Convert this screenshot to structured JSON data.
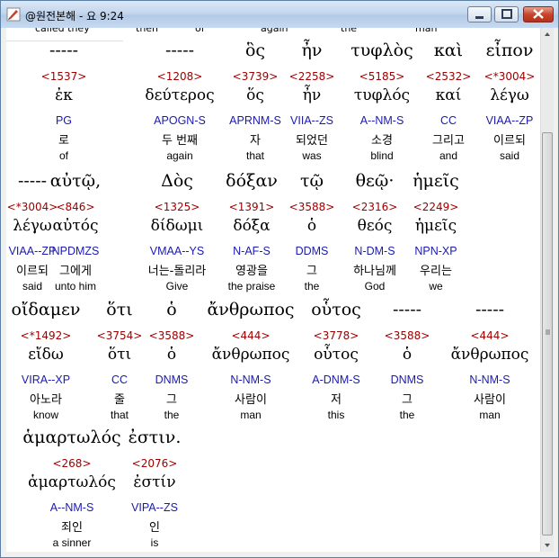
{
  "window": {
    "title": "@원전본해 - 요 9:24",
    "controls": {
      "minimize_icon": "minimize-icon",
      "maximize_icon": "maximize-icon",
      "close_icon": "close-icon"
    }
  },
  "cut_row": [
    "called they",
    "then",
    "of",
    "again",
    "the",
    "man"
  ],
  "blocks": [
    {
      "words": [
        {
          "greek": "-----",
          "number": "<1537>",
          "lemma": "ἐκ",
          "parse": "PG",
          "korean": "로",
          "english": "of"
        },
        {
          "greek": "-----",
          "number": "<1208>",
          "lemma": "δεύτερος",
          "parse": "APOGN-S",
          "korean": "두 번째",
          "english": "again"
        },
        {
          "greek": "ὃς",
          "number": "<3739>",
          "lemma": "ὅς",
          "parse": "APRNM-S",
          "korean": "자",
          "english": "that"
        },
        {
          "greek": "ἦν",
          "number": "<2258>",
          "lemma": "ἦν",
          "parse": "VIIA--ZS",
          "korean": "되었던",
          "english": "was"
        },
        {
          "greek": "τυφλὸς",
          "number": "<5185>",
          "lemma": "τυφλός",
          "parse": "A--NM-S",
          "korean": "소경",
          "english": "blind"
        },
        {
          "greek": "καὶ",
          "number": "<2532>",
          "lemma": "καί",
          "parse": "CC",
          "korean": "그리고",
          "english": "and"
        },
        {
          "greek": "εἶπον",
          "number": "<*3004>",
          "lemma": "λέγω",
          "parse": "VIAA--ZP",
          "korean": "이르되",
          "english": "said"
        }
      ]
    },
    {
      "words": [
        {
          "greek": "-----",
          "number": "<*3004>",
          "lemma": "λέγω",
          "parse": "VIAA--ZP",
          "korean": "이르되",
          "english": "said"
        },
        {
          "greek": "αὐτῷ,",
          "number": "<846>",
          "lemma": "αὐτός",
          "parse": "NPDMZS",
          "korean": "그에게",
          "english": "unto him"
        },
        {
          "greek": "Δὸς",
          "number": "<1325>",
          "lemma": "δίδωμι",
          "parse": "VMAA--YS",
          "korean": "너는-돌리라",
          "english": "Give"
        },
        {
          "greek": "δόξαν",
          "number": "<1391>",
          "lemma": "δόξα",
          "parse": "N-AF-S",
          "korean": "영광을",
          "english": "the praise"
        },
        {
          "greek": "τῷ",
          "number": "<3588>",
          "lemma": "ὁ",
          "parse": "DDMS",
          "korean": "그",
          "english": "the"
        },
        {
          "greek": "θεῷ·",
          "number": "<2316>",
          "lemma": "θεός",
          "parse": "N-DM-S",
          "korean": "하나님께",
          "english": "God"
        },
        {
          "greek": "ἡμεῖς",
          "number": "<2249>",
          "lemma": "ἡμεῖς",
          "parse": "NPN-XP",
          "korean": "우리는",
          "english": "we"
        }
      ]
    },
    {
      "words": [
        {
          "greek": "οἴδαμεν",
          "number": "<*1492>",
          "lemma": "εἴδω",
          "parse": "VIRA--XP",
          "korean": "아노라",
          "english": "know"
        },
        {
          "greek": "ὅτι",
          "number": "<3754>",
          "lemma": "ὅτι",
          "parse": "CC",
          "korean": "줄",
          "english": "that"
        },
        {
          "greek": "ὁ",
          "number": "<3588>",
          "lemma": "ὁ",
          "parse": "DNMS",
          "korean": "그",
          "english": "the"
        },
        {
          "greek": "ἄνθρωπος",
          "number": "<444>",
          "lemma": "ἄνθρωπος",
          "parse": "N-NM-S",
          "korean": "사람이",
          "english": "man"
        },
        {
          "greek": "οὗτος",
          "number": "<3778>",
          "lemma": "οὗτος",
          "parse": "A-DNM-S",
          "korean": "저",
          "english": "this"
        },
        {
          "greek": "-----",
          "number": "<3588>",
          "lemma": "ὁ",
          "parse": "DNMS",
          "korean": "그",
          "english": "the"
        },
        {
          "greek": "-----",
          "number": "<444>",
          "lemma": "ἄνθρωπος",
          "parse": "N-NM-S",
          "korean": "사람이",
          "english": "man"
        }
      ]
    },
    {
      "words": [
        {
          "greek": "ἁμαρτωλός",
          "number": "<268>",
          "lemma": "ἁμαρτωλός",
          "parse": "A--NM-S",
          "korean": "죄인",
          "english": "a sinner"
        },
        {
          "greek": "ἐστιν.",
          "number": "<2076>",
          "lemma": "ἐστίν",
          "parse": "VIPA--ZS",
          "korean": "인",
          "english": "is"
        }
      ]
    }
  ]
}
